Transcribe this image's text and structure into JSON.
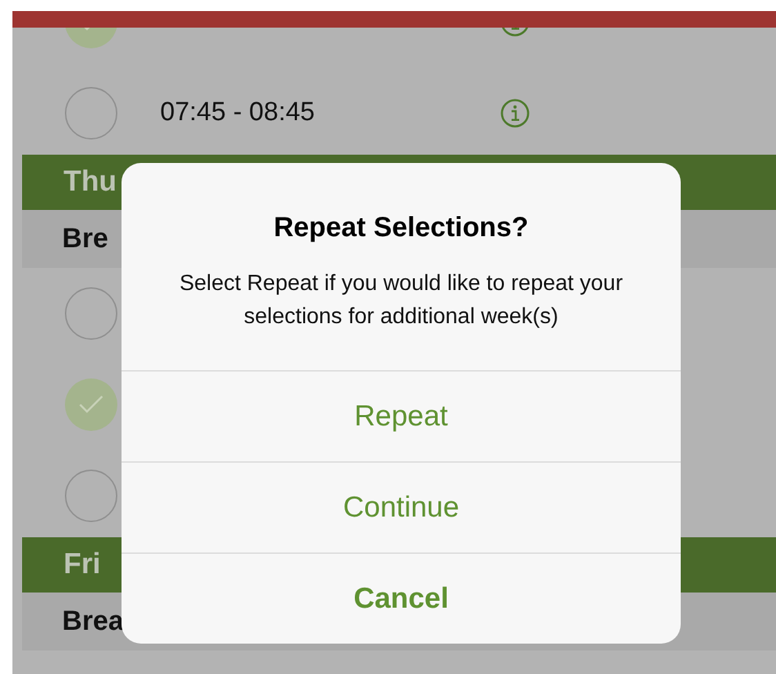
{
  "top_slots": [
    {
      "selected": true,
      "info": true
    },
    {
      "time": "07:45 - 08:45",
      "selected": false,
      "info": true
    }
  ],
  "days": [
    {
      "day": "Thu",
      "meal": "Bre",
      "slots": [
        {
          "selected": false
        },
        {
          "selected": true
        },
        {
          "selected": false
        }
      ]
    },
    {
      "day": "Fri",
      "meal": "Brea"
    }
  ],
  "dialog": {
    "title": "Repeat Selections?",
    "message": "Select Repeat if you would like to repeat your selections for additional week(s)",
    "buttons": [
      {
        "label": "Repeat",
        "bold": false
      },
      {
        "label": "Continue",
        "bold": false
      },
      {
        "label": "Cancel",
        "bold": true
      }
    ]
  }
}
